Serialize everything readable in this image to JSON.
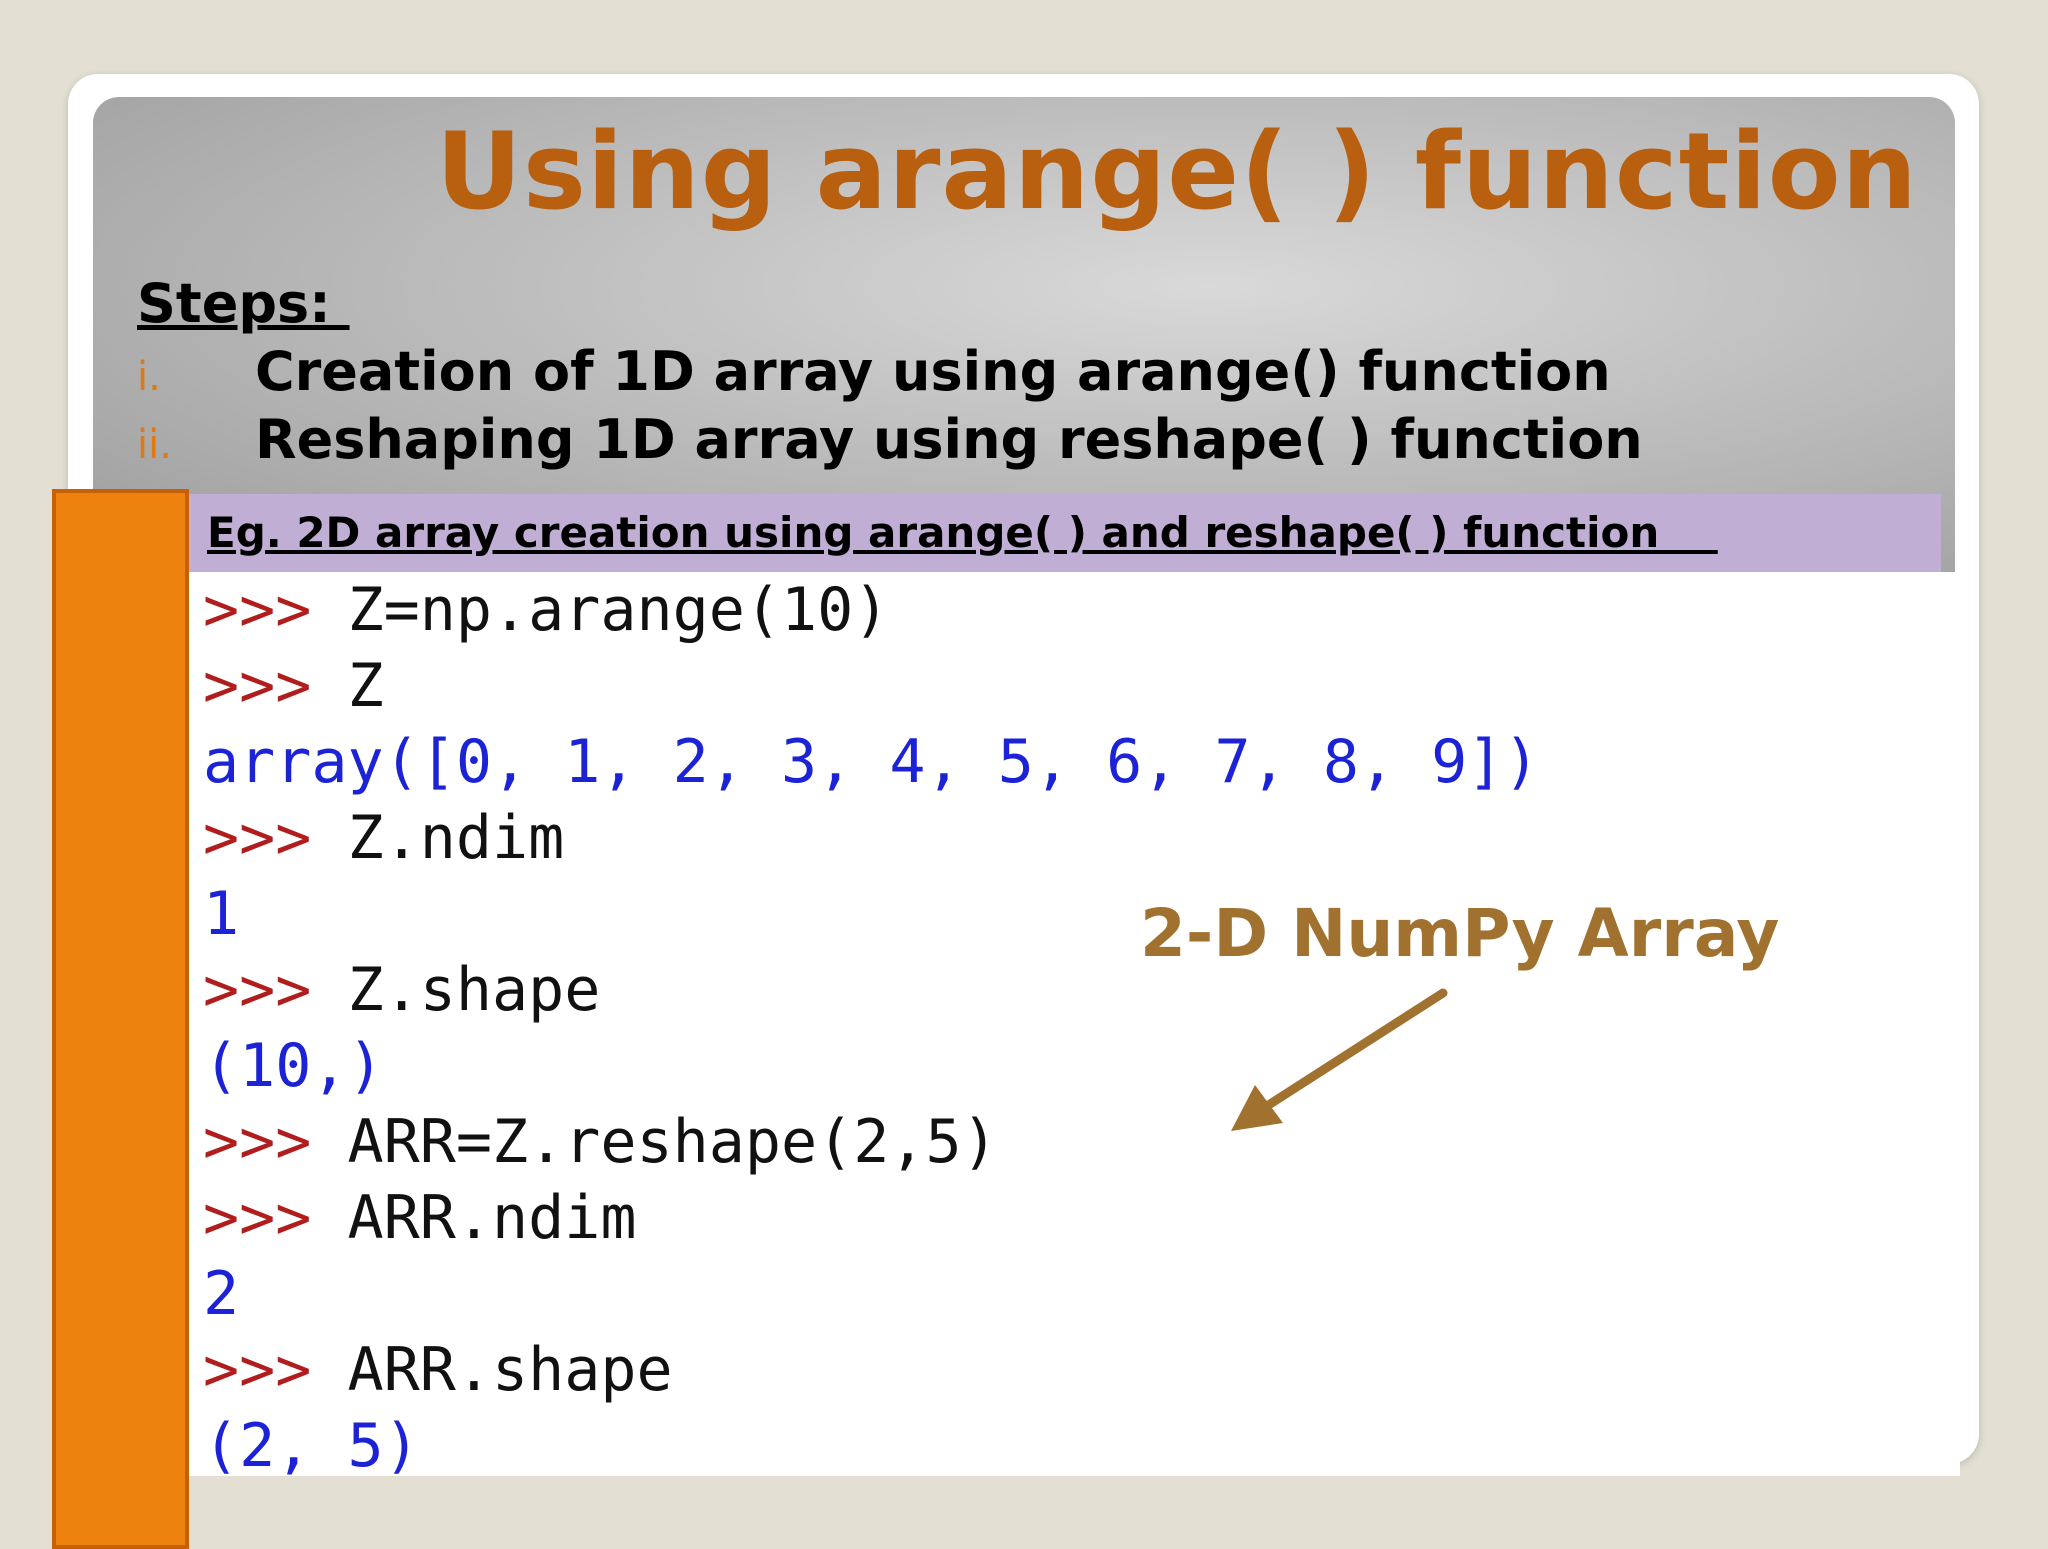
{
  "slide": {
    "title": "Using arange( ) function",
    "steps_heading": "Steps: ",
    "steps": [
      {
        "number": "i.",
        "text": "Creation of 1D array using arange() function"
      },
      {
        "number": "ii.",
        "text": "Reshaping 1D array using reshape( ) function"
      }
    ],
    "example_banner": "Eg. 2D array creation using arange( ) and reshape( ) function    ",
    "code_lines": [
      {
        "prompt": ">>> ",
        "cmd": "Z=np.arange(10)",
        "out": ""
      },
      {
        "prompt": ">>> ",
        "cmd": "Z",
        "out": ""
      },
      {
        "prompt": "",
        "cmd": "",
        "out": "array([0, 1, 2, 3, 4, 5, 6, 7, 8, 9])"
      },
      {
        "prompt": ">>> ",
        "cmd": "Z.ndim",
        "out": ""
      },
      {
        "prompt": "",
        "cmd": "",
        "out": "1"
      },
      {
        "prompt": ">>> ",
        "cmd": "Z.shape",
        "out": ""
      },
      {
        "prompt": "",
        "cmd": "",
        "out": "(10,)"
      },
      {
        "prompt": ">>> ",
        "cmd": "ARR=Z.reshape(2,5)",
        "out": ""
      },
      {
        "prompt": ">>> ",
        "cmd": "ARR.ndim",
        "out": ""
      },
      {
        "prompt": "",
        "cmd": "",
        "out": "2"
      },
      {
        "prompt": ">>> ",
        "cmd": "ARR.shape",
        "out": ""
      },
      {
        "prompt": "",
        "cmd": "",
        "out": "(2, 5)"
      }
    ],
    "annotation": "2-D NumPy Array",
    "colors": {
      "title": "#b8600f",
      "step_number": "#e07a10",
      "accent_bar": "#ee820f",
      "banner": "#c0aed4",
      "prompt": "#b11c1c",
      "output": "#1c22d6",
      "annotation": "#a1722f"
    }
  }
}
